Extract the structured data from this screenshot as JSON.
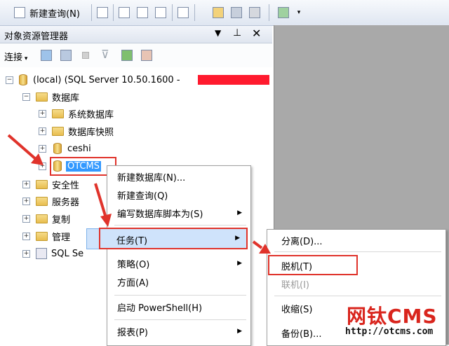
{
  "toolbar": {
    "new_query_label": "新建查询(N)"
  },
  "panel": {
    "title": "对象资源管理器",
    "connect_label": "连接",
    "pin_glyph": "上",
    "close_glyph": "✕"
  },
  "tree": {
    "server": "(local) (SQL Server 10.50.1600 -",
    "databases": "数据库",
    "system_dbs": "系统数据库",
    "snapshots": "数据库快照",
    "db1": "ceshi",
    "db2": "OTCMS",
    "security": "安全性",
    "server_objects": "服务器",
    "replication": "复制",
    "management": "管理",
    "sql_agent": "SQL Se"
  },
  "context_menu": {
    "new_db": "新建数据库(N)...",
    "new_query": "新建查询(Q)",
    "script_db": "编写数据库脚本为(S)",
    "tasks": "任务(T)",
    "policies": "策略(O)",
    "facets": "方面(A)",
    "powershell": "启动 PowerShell(H)",
    "reports": "报表(P)"
  },
  "submenu": {
    "detach": "分离(D)...",
    "take_offline": "脱机(T)",
    "bring_online": "联机(I)",
    "shrink": "收缩(S)",
    "backup": "备份(B)..."
  },
  "watermark": {
    "brand": "网钛CMS",
    "url": "http://otcms.com"
  },
  "colors": {
    "highlight": "#3399ff",
    "annotation": "#e0332b"
  }
}
